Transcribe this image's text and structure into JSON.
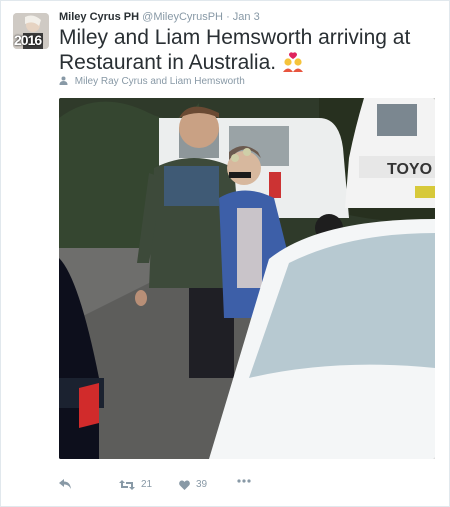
{
  "tweet": {
    "avatar_year": "2016",
    "name": "Miley Cyrus PH",
    "handle": "@MileyCyrusPH",
    "separator": "·",
    "date": "Jan 3",
    "text": "Miley and Liam Hemsworth arriving at Restaurant in Australia.",
    "emoji_icon": "couple-with-heart-icon",
    "tagged_people": "Miley Ray Cyrus and Liam Hemsworth",
    "photo_truck_text": "TOYO"
  },
  "actions": {
    "retweet_count": "21",
    "like_count": "39"
  },
  "colors": {
    "text": "#292f33",
    "muted": "#8899a6",
    "border": "#e1e8ed"
  }
}
